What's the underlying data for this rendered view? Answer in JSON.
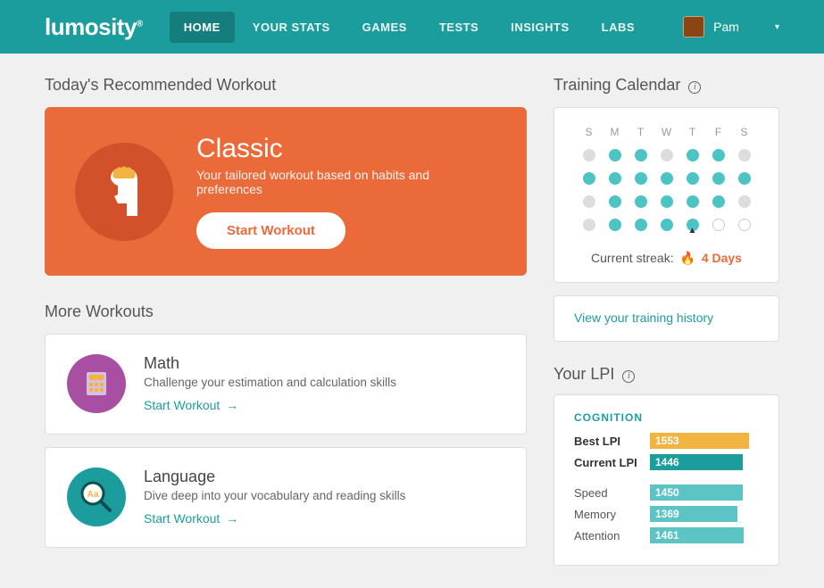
{
  "nav": {
    "logo": "lumosity",
    "items": [
      "HOME",
      "YOUR STATS",
      "GAMES",
      "TESTS",
      "INSIGHTS",
      "LABS"
    ],
    "activeIndex": 0,
    "user": "Pam"
  },
  "today": {
    "heading": "Today's Recommended Workout",
    "workout": {
      "title": "Classic",
      "subtitle": "Your tailored workout based on habits and preferences",
      "cta": "Start Workout"
    }
  },
  "more": {
    "heading": "More Workouts",
    "items": [
      {
        "title": "Math",
        "desc": "Challenge your estimation and calculation skills",
        "cta": "Start Workout",
        "iconBg": "#a84fa3",
        "icon": "calculator"
      },
      {
        "title": "Language",
        "desc": "Dive deep into your vocabulary and reading skills",
        "cta": "Start Workout",
        "iconBg": "#1c9d9d",
        "icon": "magnifier"
      }
    ]
  },
  "calendar": {
    "heading": "Training Calendar",
    "dayHeaders": [
      "S",
      "M",
      "T",
      "W",
      "T",
      "F",
      "S"
    ],
    "weeks": [
      [
        "missed",
        "done",
        "done",
        "missed",
        "done",
        "done",
        "missed"
      ],
      [
        "done",
        "done",
        "done",
        "done",
        "done",
        "done",
        "done"
      ],
      [
        "missed",
        "done",
        "done",
        "done",
        "done",
        "done",
        "missed"
      ],
      [
        "missed",
        "done",
        "done",
        "done",
        "done",
        "future",
        "future"
      ]
    ],
    "todayIndex": [
      3,
      4
    ],
    "streakLabel": "Current streak:",
    "streakValue": "4 Days",
    "historyLink": "View your training history"
  },
  "lpi": {
    "heading": "Your LPI",
    "group": "COGNITION",
    "max": 1700,
    "rows": [
      {
        "name": "Best LPI",
        "value": 1553,
        "style": "gold",
        "bold": true
      },
      {
        "name": "Current LPI",
        "value": 1446,
        "style": "teal-dark",
        "bold": true
      },
      {
        "gap": true
      },
      {
        "name": "Speed",
        "value": 1450,
        "style": "teal"
      },
      {
        "name": "Memory",
        "value": 1369,
        "style": "teal"
      },
      {
        "name": "Attention",
        "value": 1461,
        "style": "teal"
      }
    ]
  }
}
